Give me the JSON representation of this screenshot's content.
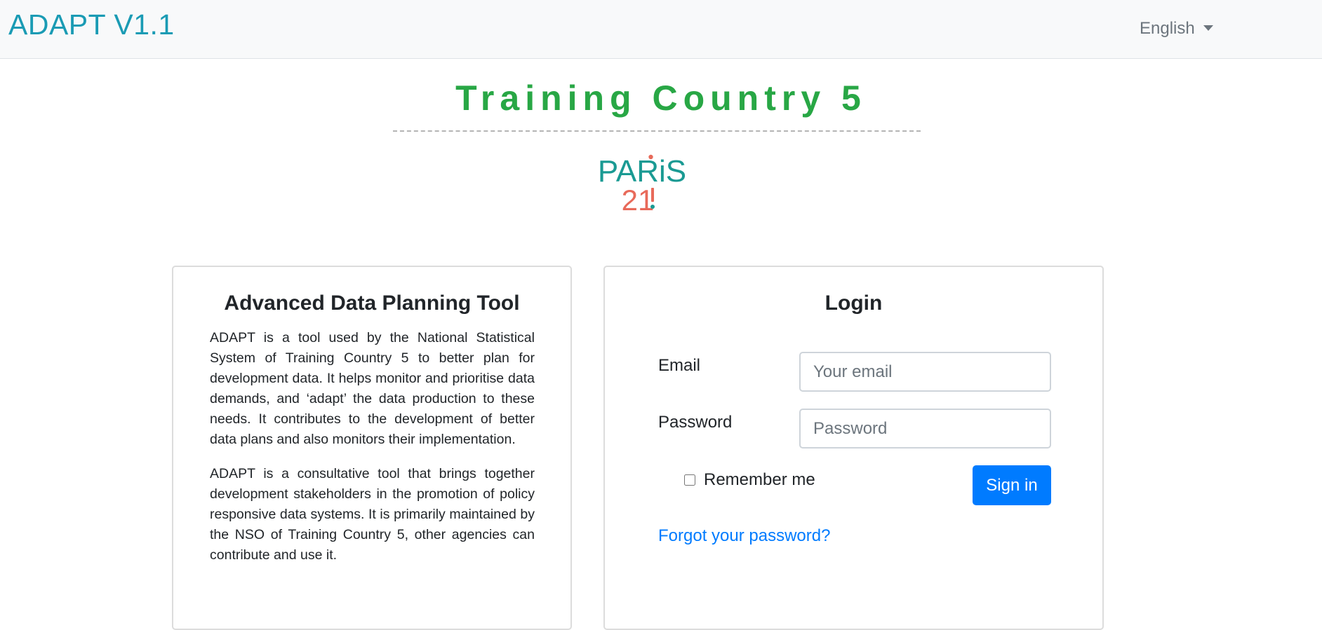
{
  "navbar": {
    "brand": "ADAPT V1.1",
    "language": "English"
  },
  "header": {
    "country_title": "Training Country 5",
    "logo": {
      "line1": "PARiS",
      "line2": "21",
      "colors": {
        "teal": "#1a9a93",
        "coral": "#e86a5a"
      }
    }
  },
  "about": {
    "title": "Advanced Data Planning Tool",
    "paragraphs": [
      "ADAPT is a tool used by the National Statistical System of Training Country 5 to better plan for development data. It helps monitor and prioritise data demands, and ‘adapt’ the data production to these needs. It contributes to the development of better data plans and also monitors their implementation.",
      "ADAPT is a consultative tool that brings together development stakeholders in the promotion of policy responsive data systems. It is primarily maintained by the NSO of Training Country 5, other agencies can contribute and use it."
    ]
  },
  "login": {
    "title": "Login",
    "email_label": "Email",
    "email_placeholder": "Your email",
    "password_label": "Password",
    "password_placeholder": "Password",
    "remember_label": "Remember me",
    "signin_label": "Sign in",
    "forgot_label": "Forgot your password?"
  },
  "colors": {
    "brand": "#1a9bb4",
    "title_green": "#28a745",
    "primary": "#007bff",
    "navbar_bg": "#f8f9fa"
  }
}
